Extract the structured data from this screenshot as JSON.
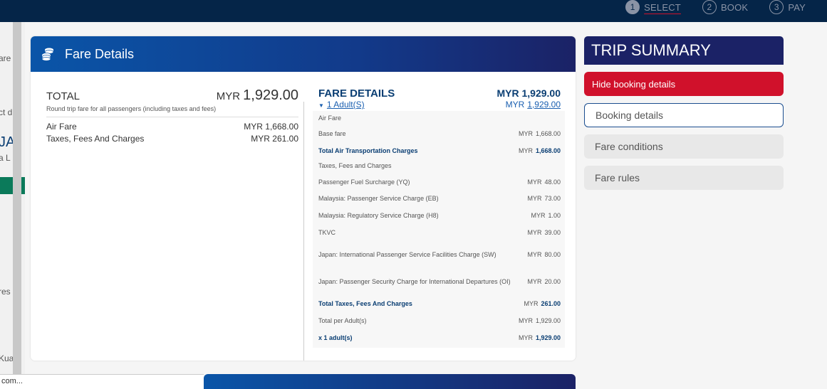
{
  "steps": [
    {
      "num": "1",
      "label": "SELECT"
    },
    {
      "num": "2",
      "label": "BOOK"
    },
    {
      "num": "3",
      "label": "PAY"
    }
  ],
  "background": {
    "fragments": [
      "are",
      "ct d",
      "JA",
      "a L",
      "res",
      "Kua"
    ]
  },
  "fare_panel": {
    "title": "Fare Details",
    "total_label": "TOTAL",
    "total_currency": "MYR",
    "total_amount": "1,929.00",
    "total_note": "Round trip fare for all passengers (including taxes and fees)",
    "summary": [
      {
        "label": "Air Fare",
        "value": "MYR 1,668.00"
      },
      {
        "label": "Taxes, Fees And Charges",
        "value": "MYR 261.00"
      }
    ],
    "details": {
      "title": "FARE DETAILS",
      "total": "MYR 1,929.00",
      "adult_link": "1 Adult(S)",
      "adult_currency": "MYR",
      "adult_amount": "1,929.00",
      "rows": [
        {
          "label": "Air Fare",
          "cur": "",
          "num": "",
          "bold": false
        },
        {
          "label": "Base fare",
          "cur": "MYR",
          "num": "1,668.00",
          "bold": false
        },
        {
          "label": "Total Air Transportation Charges",
          "cur": "MYR",
          "num": "1,668.00",
          "bold": true
        },
        {
          "label": "Taxes, Fees and Charges",
          "cur": "",
          "num": "",
          "bold": false
        },
        {
          "label": "Passenger Fuel Surcharge (YQ)",
          "cur": "MYR",
          "num": "48.00",
          "bold": false
        },
        {
          "label": "Malaysia: Passenger Service Charge (EB)",
          "cur": "MYR",
          "num": "73.00",
          "bold": false
        },
        {
          "label": "Malaysia: Regulatory Service Charge (H8)",
          "cur": "MYR",
          "num": "1.00",
          "bold": false
        },
        {
          "label": "TKVC",
          "cur": "MYR",
          "num": "39.00",
          "bold": false
        },
        {
          "label": "Japan: International Passenger Service Facilities Charge (SW)",
          "cur": "MYR",
          "num": "80.00",
          "bold": false
        },
        {
          "label": "Japan: Passenger Security Charge for International Departures (OI)",
          "cur": "MYR",
          "num": "20.00",
          "bold": false
        },
        {
          "label": "Total Taxes, Fees And Charges",
          "cur": "MYR",
          "num": "261.00",
          "bold": true
        },
        {
          "label": "Total per Adult(s)",
          "cur": "MYR",
          "num": "1,929.00",
          "bold": false
        },
        {
          "label": "x 1 adult(s)",
          "cur": "MYR",
          "num": "1,929.00",
          "bold": true
        }
      ]
    }
  },
  "trip_summary": {
    "title": "TRIP SUMMARY",
    "hide_button": "Hide booking details",
    "options": [
      "Booking details",
      "Fare conditions",
      "Fare rules"
    ]
  },
  "status_bar": "com..."
}
